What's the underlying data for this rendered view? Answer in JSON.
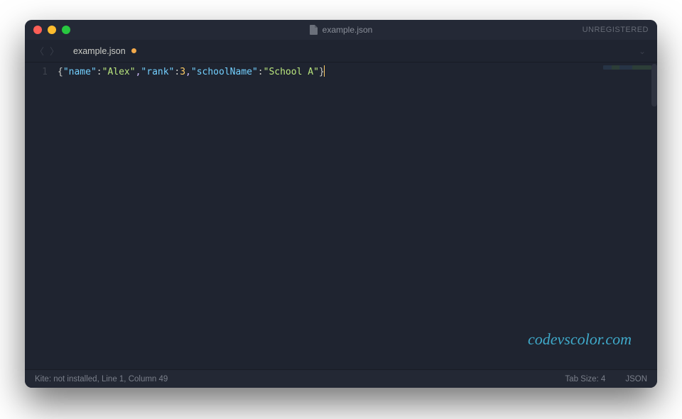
{
  "titlebar": {
    "filename": "example.json",
    "unregistered_label": "UNREGISTERED"
  },
  "tabs": {
    "active": {
      "label": "example.json",
      "modified": true
    }
  },
  "editor": {
    "line_number": "1",
    "code_tokens": {
      "brace_open": "{",
      "key_name": "\"name\"",
      "colon1": ":",
      "val_alex": "\"Alex\"",
      "comma1": ",",
      "key_rank": "\"rank\"",
      "colon2": ":",
      "val_3": "3",
      "comma2": ",",
      "key_school": "\"schoolName\"",
      "colon3": ":",
      "val_school": "\"School A\"",
      "brace_close": "}"
    }
  },
  "statusbar": {
    "left": "Kite: not installed, Line 1, Column 49",
    "tabsize": "Tab Size: 4",
    "syntax": "JSON"
  },
  "watermark": "codevscolor.com"
}
